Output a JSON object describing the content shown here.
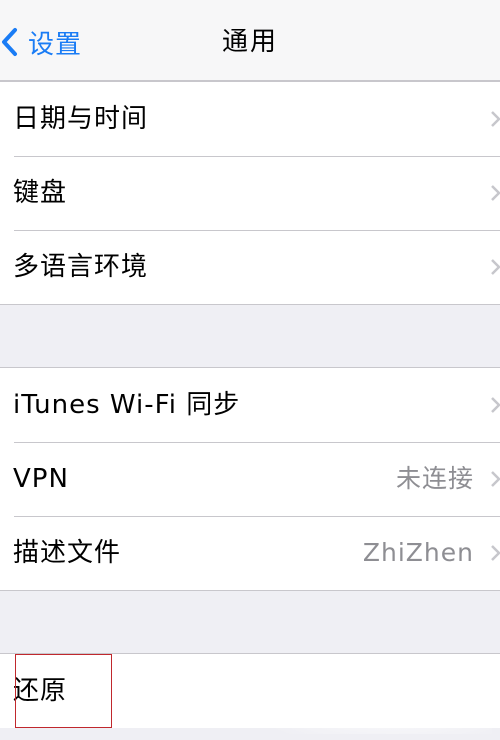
{
  "nav": {
    "back_label": "设置",
    "title": "通用"
  },
  "groups": [
    {
      "rows": [
        {
          "label": "日期与时间",
          "value": ""
        },
        {
          "label": "键盘",
          "value": ""
        },
        {
          "label": "多语言环境",
          "value": ""
        }
      ]
    },
    {
      "rows": [
        {
          "label": "iTunes Wi-Fi 同步",
          "value": ""
        },
        {
          "label": "VPN",
          "value": "未连接"
        },
        {
          "label": "描述文件",
          "value": "ZhiZhen"
        }
      ]
    },
    {
      "rows": [
        {
          "label": "还原",
          "value": ""
        }
      ]
    }
  ],
  "colors": {
    "accent": "#1a7cf5",
    "background": "#efeff4",
    "separator": "#c8c7cc",
    "secondary_text": "#8e8e93",
    "annotation": "#c0282d"
  },
  "icons": {
    "back": "chevron-left-icon",
    "disclosure": "chevron-right-icon"
  }
}
